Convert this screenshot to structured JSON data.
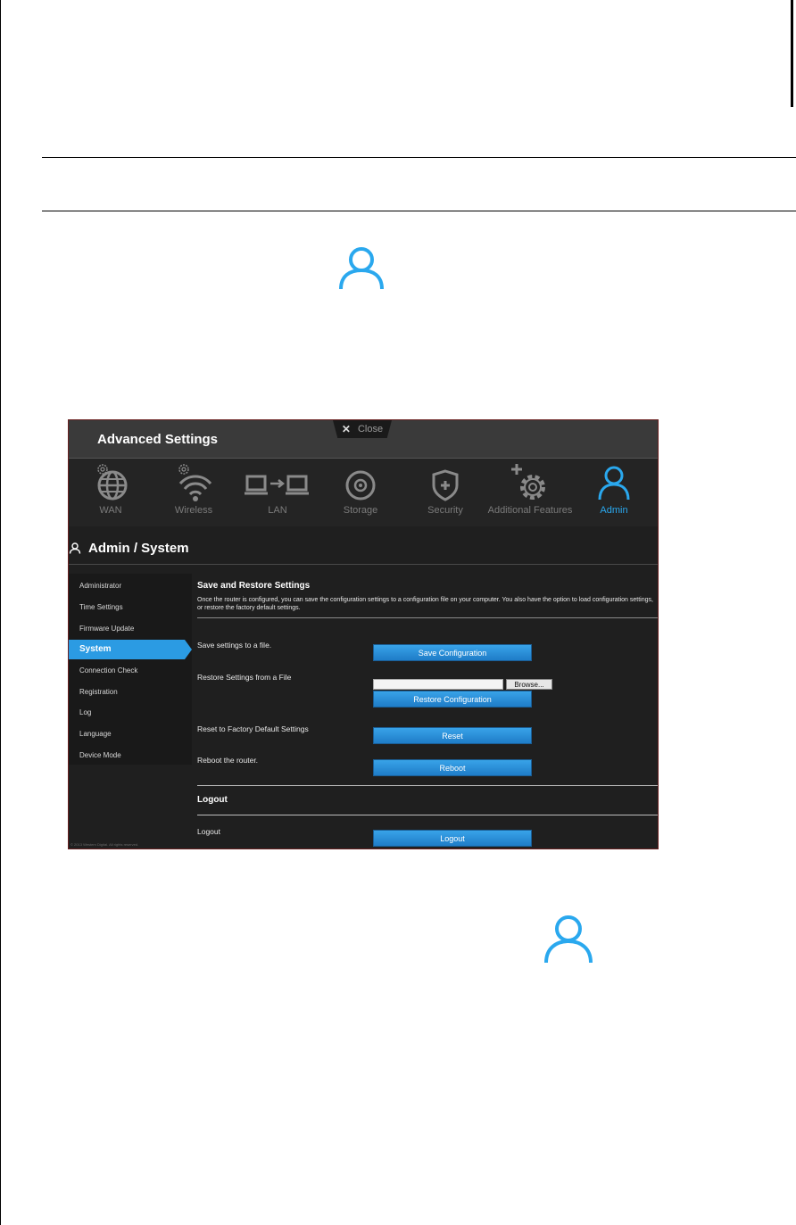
{
  "window": {
    "title": "Advanced Settings",
    "close_label": "Close"
  },
  "nav": {
    "items": [
      {
        "label": "WAN",
        "icon": "globe-gear-icon"
      },
      {
        "label": "Wireless",
        "icon": "wifi-gear-icon"
      },
      {
        "label": "LAN",
        "icon": "lan-icon"
      },
      {
        "label": "Storage",
        "icon": "disc-icon"
      },
      {
        "label": "Security",
        "icon": "shield-icon"
      },
      {
        "label": "Additional Features",
        "icon": "gear-plus-icon"
      },
      {
        "label": "Admin",
        "icon": "person-icon"
      }
    ],
    "active": "Admin"
  },
  "page": {
    "heading": "Admin / System"
  },
  "sidebar": {
    "items": [
      {
        "label": "Administrator"
      },
      {
        "label": "Time Settings"
      },
      {
        "label": "Firmware Update"
      },
      {
        "label": "System"
      },
      {
        "label": "Connection Check"
      },
      {
        "label": "Registration"
      },
      {
        "label": "Log"
      },
      {
        "label": "Language"
      },
      {
        "label": "Device Mode"
      }
    ],
    "active": "System"
  },
  "content": {
    "save_restore_title": "Save and Restore Settings",
    "save_restore_desc": "Once the router is configured, you can save the configuration settings to a configuration file on your computer. You also have the option to load configuration settings, or restore the factory default settings.",
    "save_label": "Save settings to a file.",
    "save_button": "Save Configuration",
    "restore_label": "Restore Settings from a File",
    "browse_button": "Browse...",
    "restore_button": "Restore Configuration",
    "reset_label": "Reset to Factory Default Settings",
    "reset_button": "Reset",
    "reboot_label": "Reboot the router.",
    "reboot_button": "Reboot",
    "logout_title": "Logout",
    "logout_label": "Logout",
    "logout_button": "Logout"
  },
  "footer": {
    "copyright": "© 2013 Western Digital. All rights reserved."
  },
  "colors": {
    "accent": "#2aa8ee",
    "panel_bg": "#1f1f1f",
    "titlebar_bg": "#3a3a3a",
    "button": "#2b8fdc"
  }
}
